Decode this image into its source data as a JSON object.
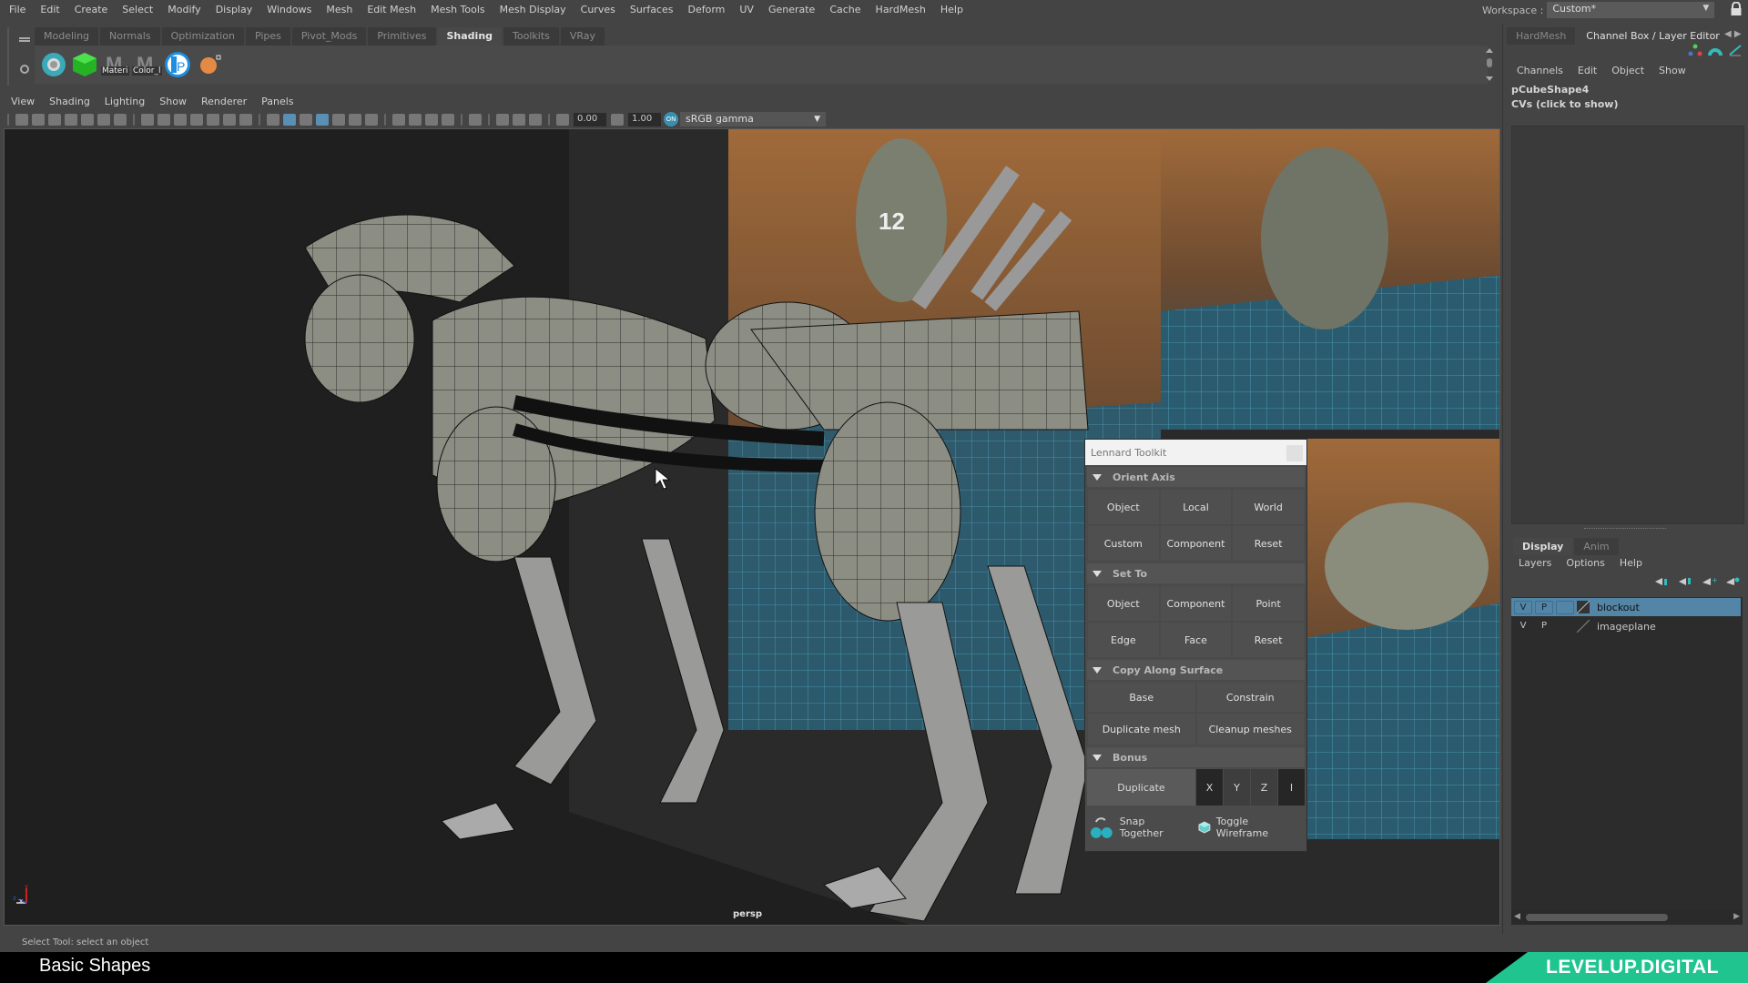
{
  "menubar": {
    "items": [
      "File",
      "Edit",
      "Create",
      "Select",
      "Modify",
      "Display",
      "Windows",
      "Mesh",
      "Edit Mesh",
      "Mesh Tools",
      "Mesh Display",
      "Curves",
      "Surfaces",
      "Deform",
      "UV",
      "Generate",
      "Cache",
      "HardMesh",
      "Help"
    ]
  },
  "workspace": {
    "label": "Workspace :",
    "value": "Custom*"
  },
  "shelf": {
    "tabs": [
      {
        "label": "Modeling",
        "active": false
      },
      {
        "label": "Normals",
        "active": false
      },
      {
        "label": "Optimization",
        "active": false
      },
      {
        "label": "Pipes",
        "active": false
      },
      {
        "label": "Pivot_Mods",
        "active": false
      },
      {
        "label": "Primitives",
        "active": false
      },
      {
        "label": "Shading",
        "active": true
      },
      {
        "label": "Toolkits",
        "active": false
      },
      {
        "label": "VRay",
        "active": false
      }
    ],
    "icons": [
      {
        "name": "hypershade-icon",
        "label": ""
      },
      {
        "name": "green-cube-icon",
        "label": ""
      },
      {
        "name": "material-icon",
        "label": "Materi"
      },
      {
        "name": "color-material-icon",
        "label": "Color_l"
      },
      {
        "name": "paint-icon",
        "label": ""
      },
      {
        "name": "orange-sphere-icon",
        "label": ""
      }
    ]
  },
  "right_panel": {
    "tabs": [
      {
        "label": "HardMesh",
        "active": false
      },
      {
        "label": "Channel Box / Layer Editor",
        "active": true
      }
    ],
    "channel_menu": [
      "Channels",
      "Edit",
      "Object",
      "Show"
    ],
    "object_name": "pCubeShape4",
    "cvs_label": "CVs (click to show)",
    "layer_tabs": [
      {
        "label": "Display",
        "active": true
      },
      {
        "label": "Anim",
        "active": false
      }
    ],
    "layer_menu": [
      "Layers",
      "Options",
      "Help"
    ],
    "layers": [
      {
        "v": "V",
        "p": "P",
        "name": "blockout",
        "selected": true
      },
      {
        "v": "V",
        "p": "P",
        "name": "imageplane",
        "selected": false
      }
    ]
  },
  "viewport": {
    "menu": [
      "View",
      "Shading",
      "Lighting",
      "Show",
      "Renderer",
      "Panels"
    ],
    "exposure": "0.00",
    "gamma": "1.00",
    "color_mgmt_badge": "ON",
    "color_space": "sRGB gamma",
    "camera_label": "persp",
    "axis_labels": {
      "y": "y",
      "z": "z",
      "x": "x"
    }
  },
  "toolkit": {
    "title": "Lennard Toolkit",
    "sections": {
      "orient_axis": {
        "title": "Orient Axis",
        "buttons": [
          "Object",
          "Local",
          "World",
          "Custom",
          "Component",
          "Reset"
        ]
      },
      "set_to": {
        "title": "Set To",
        "buttons": [
          "Object",
          "Component",
          "Point",
          "Edge",
          "Face",
          "Reset"
        ]
      },
      "copy_along_surface": {
        "title": "Copy Along Surface",
        "buttons": [
          "Base",
          "Constrain",
          "Duplicate mesh",
          "Cleanup meshes"
        ]
      },
      "bonus": {
        "title": "Bonus",
        "duplicate": "Duplicate",
        "axes": [
          "X",
          "Y",
          "Z",
          "I"
        ]
      }
    },
    "footer": {
      "snap": "Snap Together",
      "wireframe": "Toggle Wireframe"
    }
  },
  "status": {
    "text": "Select Tool: select an object"
  },
  "banner": {
    "title": "Basic Shapes",
    "brand": "LEVELUP.DIGITAL"
  },
  "colors": {
    "accent": "#5285a6",
    "brand": "#20c48f",
    "viewport_bg": "#1f1f1f"
  }
}
